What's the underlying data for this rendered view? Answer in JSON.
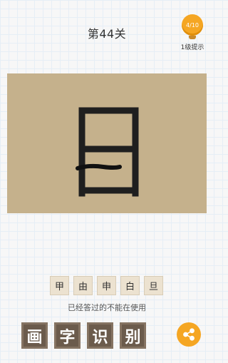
{
  "level": {
    "title": "第44关"
  },
  "hint": {
    "counter": "4/10",
    "label": "1级提示",
    "icon": "lightbulb-icon"
  },
  "board": {
    "drawn_glyph": "handwritten-character"
  },
  "choices": [
    "甲",
    "由",
    "申",
    "白",
    "旦"
  ],
  "notice": "已经答过的不能在使用",
  "answer_tiles": [
    "画",
    "字",
    "识",
    "别"
  ],
  "share": {
    "icon": "share-icon"
  },
  "colors": {
    "board": "#c5b18c",
    "accent": "#f5a623",
    "tile": "#6b5b4c",
    "choice_bg": "#ece2d0"
  }
}
